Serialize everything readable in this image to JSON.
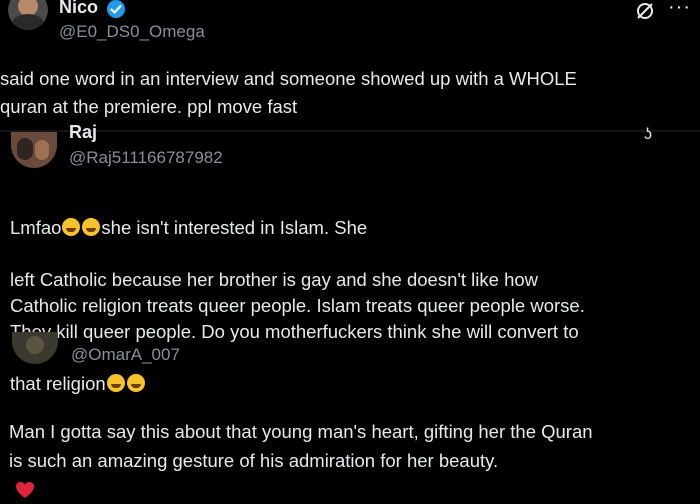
{
  "posts": [
    {
      "author": "Nico",
      "verified": true,
      "handle": "@E0_DS0_Omega",
      "text": "said one word in an interview and someone showed up with a WHOLE\nquran at the premiere. ppl move fast"
    },
    {
      "author": "Raj",
      "handle": "@Raj511166787982",
      "text_line1_start": "Lmfao",
      "text_line1_end": "she isn't interested in Islam. She",
      "text_rest": "left Catholic because her brother is gay and she doesn't like how\nCatholic religion treats queer people. Islam treats queer people worse.\nThey kill queer people. Do you motherfuckers think she will convert to",
      "text_last": "that religion"
    },
    {
      "handle": "@OmarA_007",
      "text": "Man I gotta say this about that young man's heart, gifting her the Quran\nis such an amazing gesture of his admiration for her beauty."
    }
  ],
  "icons": {
    "verified": "verified-badge-icon",
    "grok": "grok-icon",
    "heart": "heart-icon",
    "emoji": "rolling-laughing-emoji"
  },
  "colors": {
    "verified": "#1d9bf0",
    "heart": "#e0243b",
    "handle": "#8b8f94",
    "divider": "#1f1f1f"
  }
}
